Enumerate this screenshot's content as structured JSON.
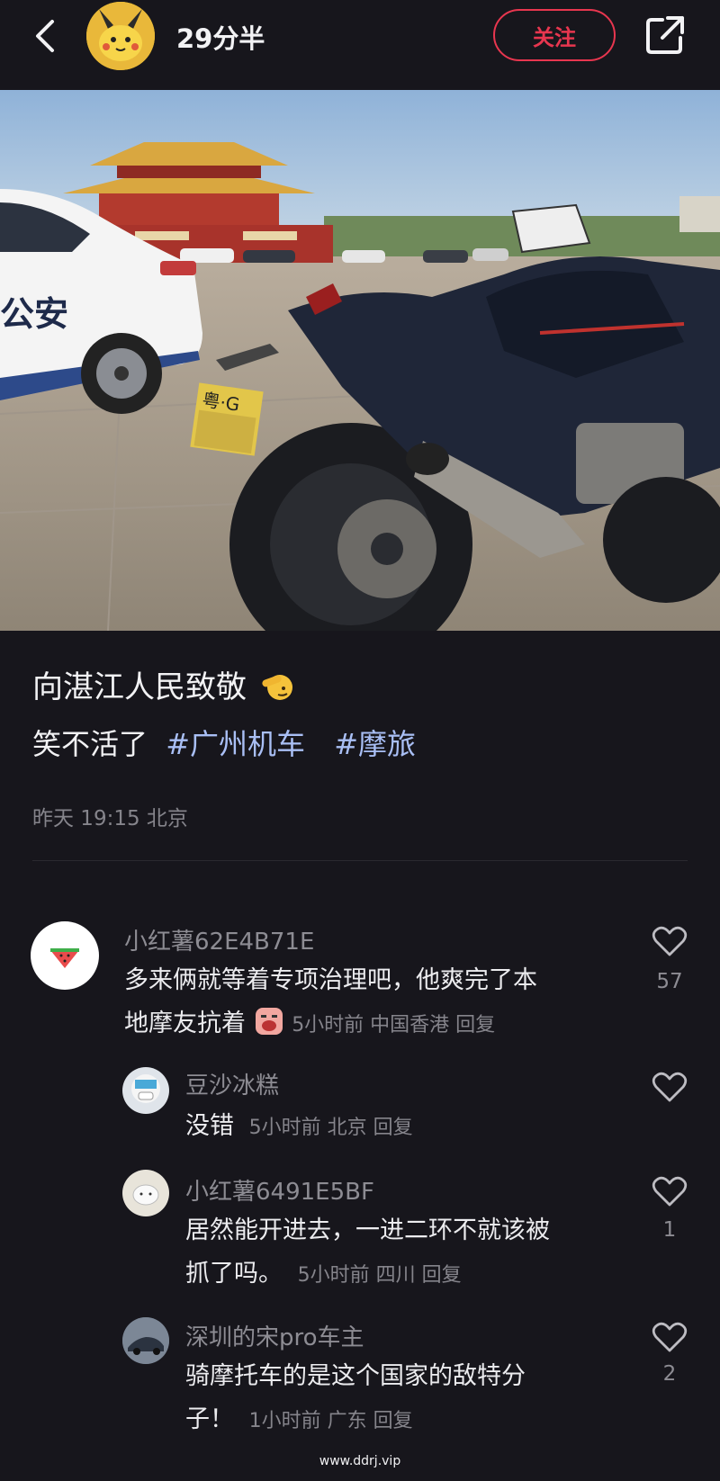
{
  "header": {
    "username": "29分半",
    "follow_label": "关注"
  },
  "post": {
    "title": "向湛江人民致敬",
    "body_text": "笑不活了",
    "tags": [
      "#广州机车",
      "#摩旅"
    ],
    "meta": "昨天 19:15 北京"
  },
  "photo": {
    "police_car_text": "公安",
    "plate_text": "粤·G"
  },
  "comments": [
    {
      "name": "小红薯62E4B71E",
      "line1": "多来俩就等着专项治理吧，他爽完了本",
      "line2": "地摩友抗着",
      "meta": "5小时前 中国香港 回复",
      "likes": "57"
    },
    {
      "name": "豆沙冰糕",
      "line1": "没错",
      "meta": "5小时前 北京 回复",
      "likes": ""
    },
    {
      "name": "小红薯6491E5BF",
      "line1": "居然能开进去，一进二环不就该被",
      "line2": "抓了吗。",
      "meta": "5小时前 四川 回复",
      "likes": "1"
    },
    {
      "name": "深圳的宋pro车主",
      "line1": "骑摩托车的是这个国家的敌特分",
      "line2": "子！",
      "meta": "1小时前 广东 回复",
      "likes": "2"
    }
  ],
  "watermark": "www.ddrj.vip",
  "colors": {
    "accent": "#e8364f",
    "tag": "#a9bff5",
    "background": "#17161c"
  }
}
